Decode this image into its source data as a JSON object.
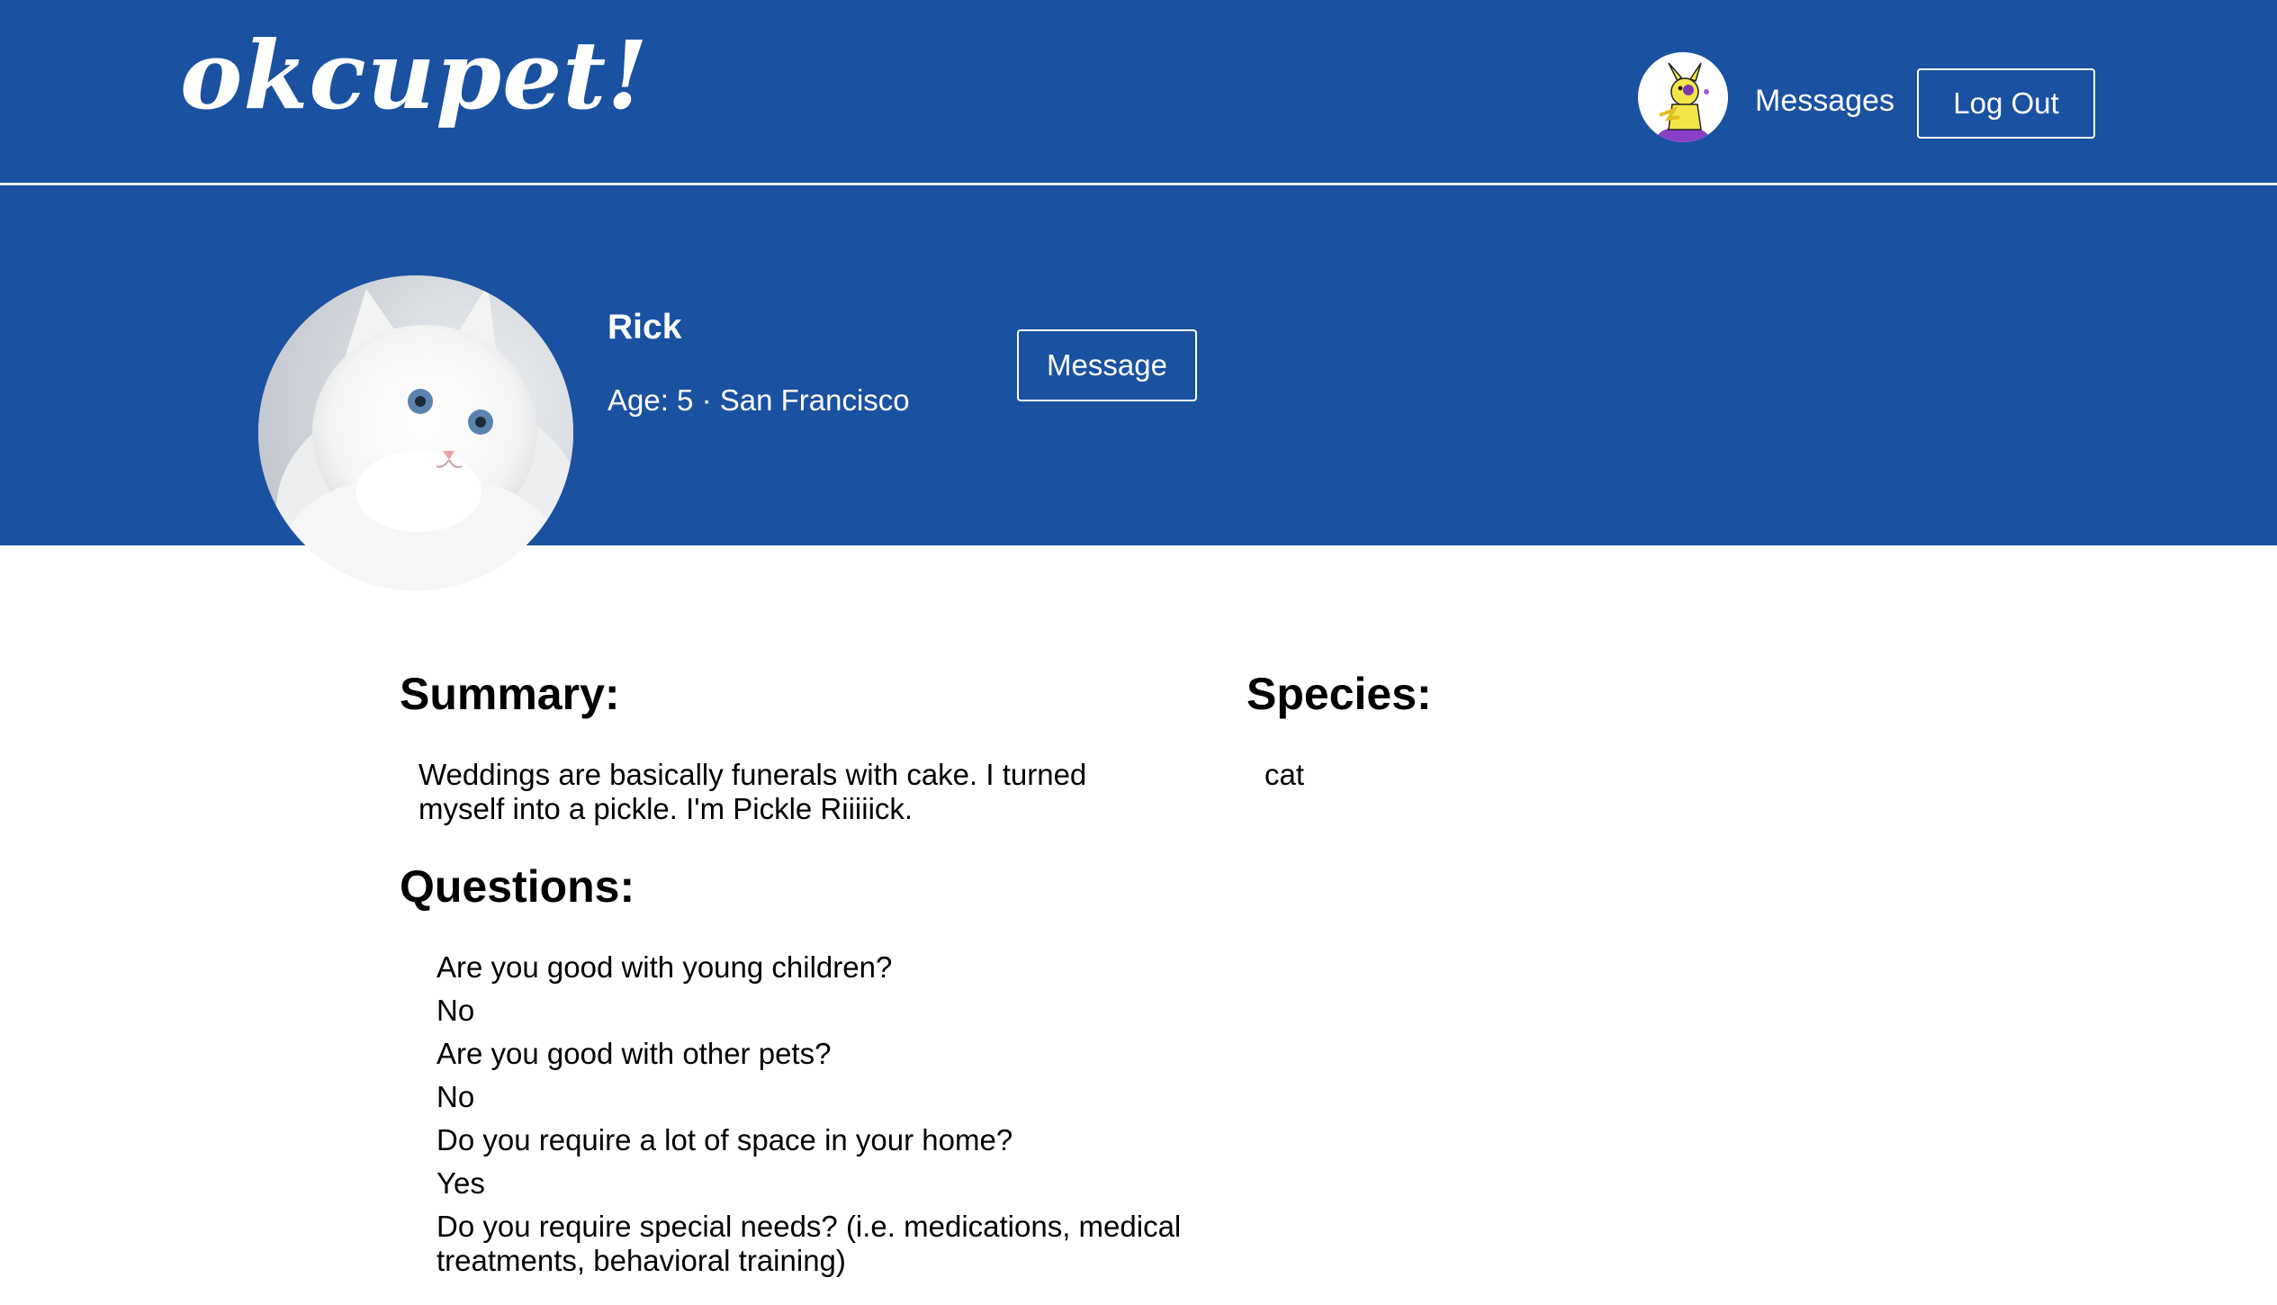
{
  "header": {
    "logo": "okcupet!",
    "messages_link": "Messages",
    "logout_label": "Log Out"
  },
  "profile": {
    "name": "Rick",
    "meta": "Age: 5 · San Francisco",
    "message_button": "Message"
  },
  "summary": {
    "heading": "Summary:",
    "text": "Weddings are basically funerals with cake. I turned myself into a pickle. I'm Pickle Riiiiick."
  },
  "species": {
    "heading": "Species:",
    "value": "cat"
  },
  "questions": {
    "heading": "Questions:",
    "items": [
      {
        "question": "Are you good with young children?",
        "answer": "No"
      },
      {
        "question": "Are you good with other pets?",
        "answer": "No"
      },
      {
        "question": "Do you require a lot of space in your home?",
        "answer": "Yes"
      },
      {
        "question": "Do you require special needs? (i.e. medications, medical treatments, behavioral training)",
        "answer": ""
      }
    ]
  },
  "colors": {
    "brand_blue": "#1a51a1",
    "text": "#000000",
    "on_brand": "#ffffff"
  },
  "icons": {
    "nav_avatar": "user-avatar-cartoon",
    "profile_photo": "white-persian-cat-photo"
  }
}
